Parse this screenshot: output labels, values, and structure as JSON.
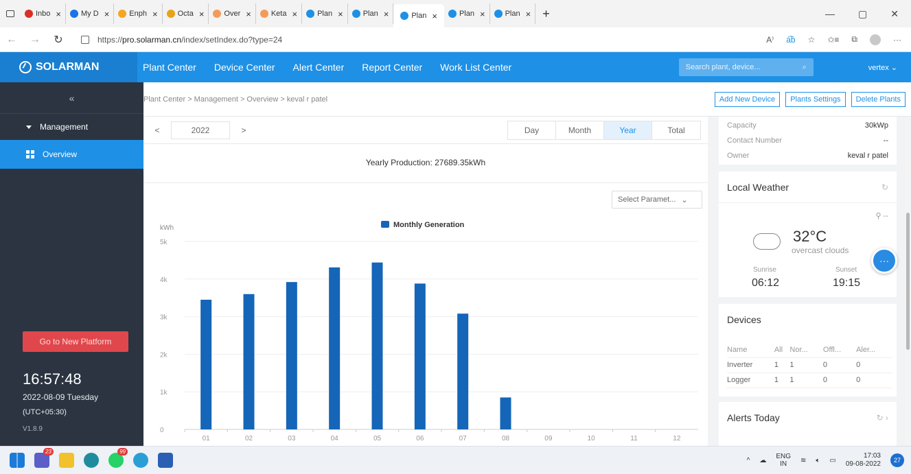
{
  "browser": {
    "tabs": [
      {
        "label": "Inbo",
        "color": "#d93025"
      },
      {
        "label": "My D",
        "color": "#1a73e8"
      },
      {
        "label": "Enph",
        "color": "#f5a623"
      },
      {
        "label": "Octa",
        "color": "#e8a317"
      },
      {
        "label": "Over",
        "color": "#f39c5a"
      },
      {
        "label": "Keta",
        "color": "#f39c5a"
      },
      {
        "label": "Plan",
        "color": "#1e90e6"
      },
      {
        "label": "Plan",
        "color": "#1e90e6"
      },
      {
        "label": "Plan",
        "color": "#1e90e6",
        "active": true
      },
      {
        "label": "Plan",
        "color": "#1e90e6"
      },
      {
        "label": "Plan",
        "color": "#1e90e6"
      }
    ],
    "url_prefix": "https://",
    "url_host": "pro.solarman.cn",
    "url_path": "/index/setIndex.do?type=24"
  },
  "app": {
    "brand": "SOLARMAN",
    "nav": [
      "Plant Center",
      "Device Center",
      "Alert Center",
      "Report Center",
      "Work List Center"
    ],
    "search_placeholder": "Search plant, device...",
    "user": "vertex"
  },
  "sidebar": {
    "collapse": "«",
    "group": "Management",
    "item": "Overview",
    "new_platform": "Go to New Platform",
    "clock": "16:57:48",
    "date": "2022-08-09 Tuesday",
    "timezone": "(UTC+05:30)",
    "version": "V1.8.9"
  },
  "breadcrumb": {
    "path": "Plant Center > Management > Overview > keval r patel",
    "actions": [
      "Add New Device",
      "Plants Settings",
      "Delete Plants"
    ]
  },
  "panel": {
    "year": "2022",
    "prev": "<",
    "next": ">",
    "periods": [
      "Day",
      "Month",
      "Year",
      "Total"
    ],
    "active_period": "Year",
    "yearly_production": "Yearly Production: 27689.35kWh",
    "select_param": "Select Paramet..."
  },
  "chart_data": {
    "type": "bar",
    "ylabel": "kWh",
    "legend": "Monthly Generation",
    "categories": [
      "01",
      "02",
      "03",
      "04",
      "05",
      "06",
      "07",
      "08",
      "09",
      "10",
      "11",
      "12"
    ],
    "values": [
      3450,
      3600,
      3920,
      4310,
      4440,
      3880,
      3080,
      850,
      0,
      0,
      0,
      0
    ],
    "yticks": [
      "0",
      "1k",
      "2k",
      "3k",
      "4k",
      "5k"
    ],
    "ylim": [
      0,
      5000
    ],
    "color": "#1565b8"
  },
  "plant_info": {
    "rows": [
      {
        "k": "Capacity",
        "v": "30kWp"
      },
      {
        "k": "Contact Number",
        "v": "--"
      },
      {
        "k": "Owner",
        "v": "keval r patel"
      }
    ]
  },
  "weather": {
    "title": "Local Weather",
    "location": "--",
    "temp": "32°C",
    "condition": "overcast clouds",
    "sunrise_label": "Sunrise",
    "sunset_label": "Sunset",
    "sunrise": "06:12",
    "sunset": "19:15"
  },
  "devices": {
    "title": "Devices",
    "headers": [
      "Name",
      "All",
      "Nor...",
      "Offl...",
      "Aler..."
    ],
    "rows": [
      [
        "Inverter",
        "1",
        "1",
        "0",
        "0"
      ],
      [
        "Logger",
        "1",
        "1",
        "0",
        "0"
      ]
    ]
  },
  "alerts": {
    "title": "Alerts Today"
  },
  "taskbar": {
    "lang1": "ENG",
    "lang2": "IN",
    "time": "17:03",
    "date": "09-08-2022",
    "notifications": "27",
    "badge1": "23",
    "badge2": "99"
  }
}
